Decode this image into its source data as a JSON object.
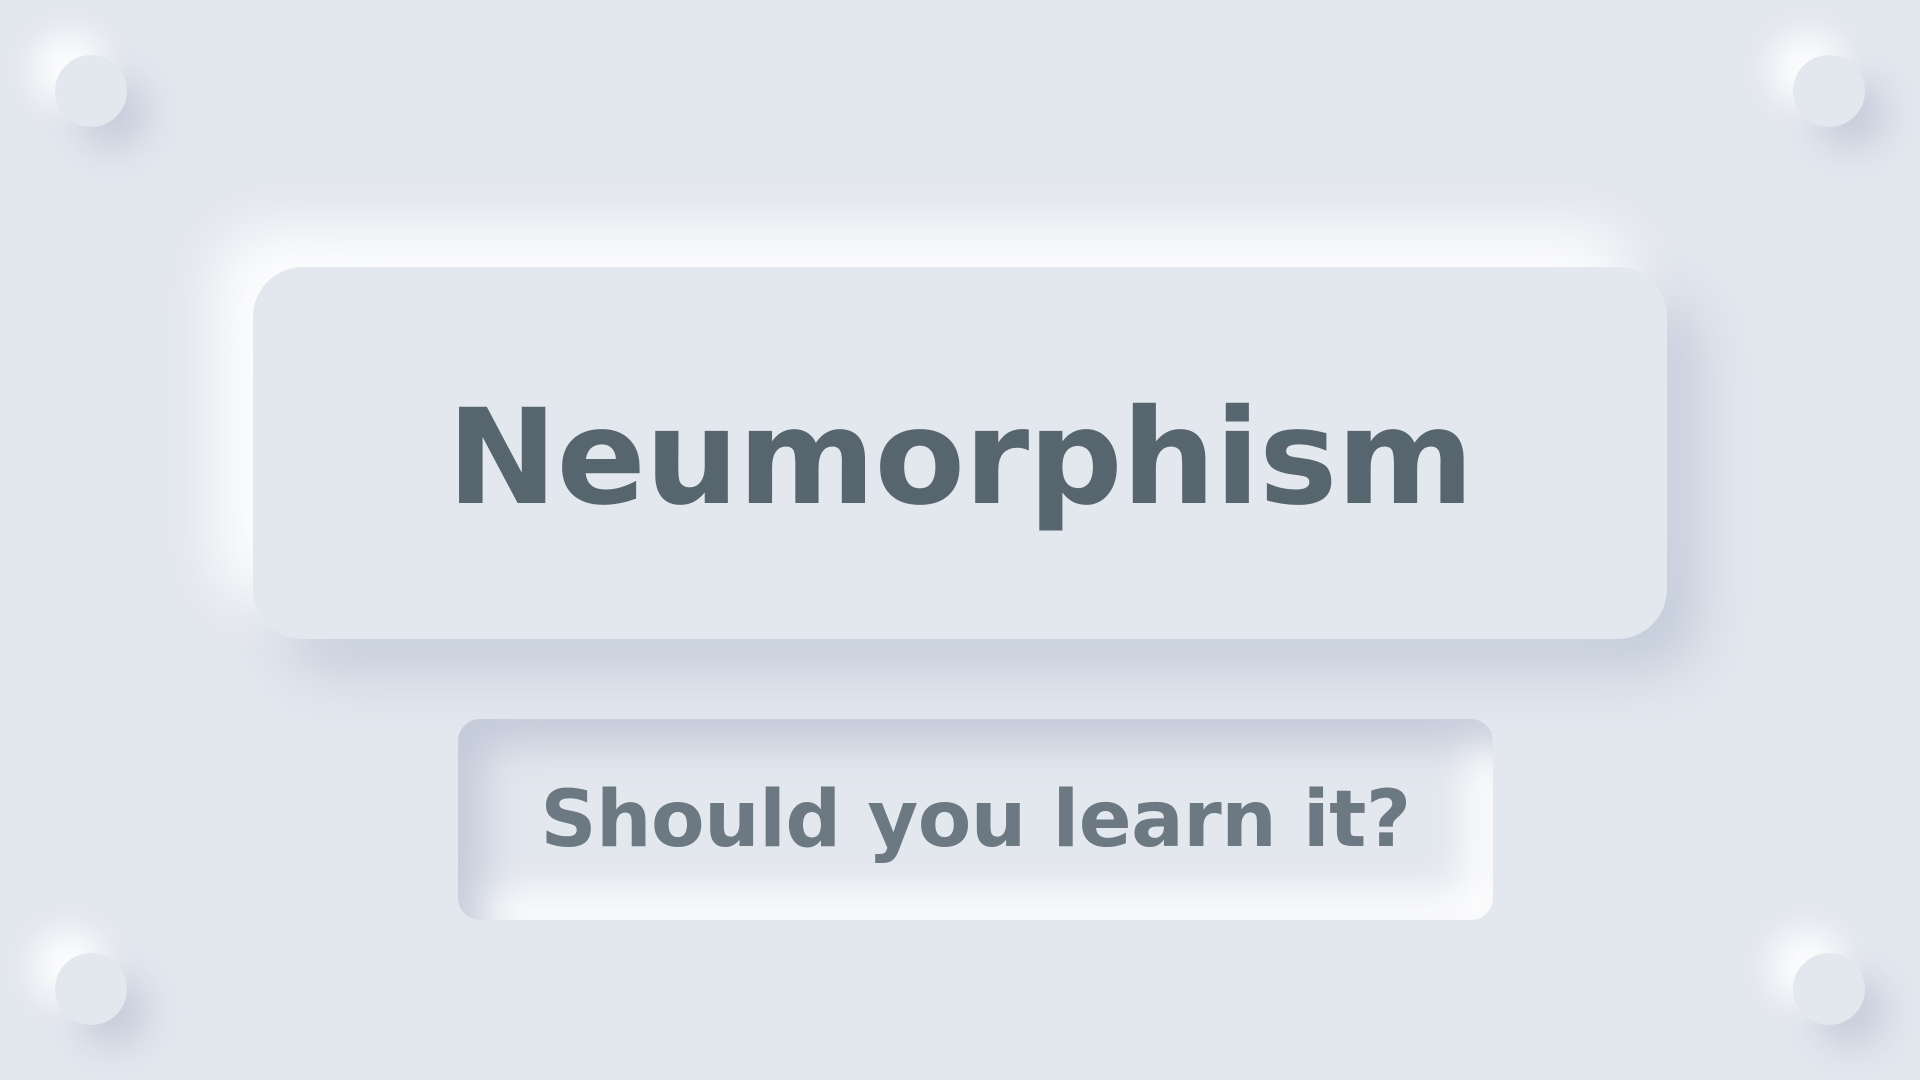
{
  "title": "Neumorphism",
  "subtitle": "Should you learn it?",
  "colors": {
    "background": "#e3e7ee",
    "title_text": "#57656f",
    "subtitle_text": "#6c7882"
  }
}
